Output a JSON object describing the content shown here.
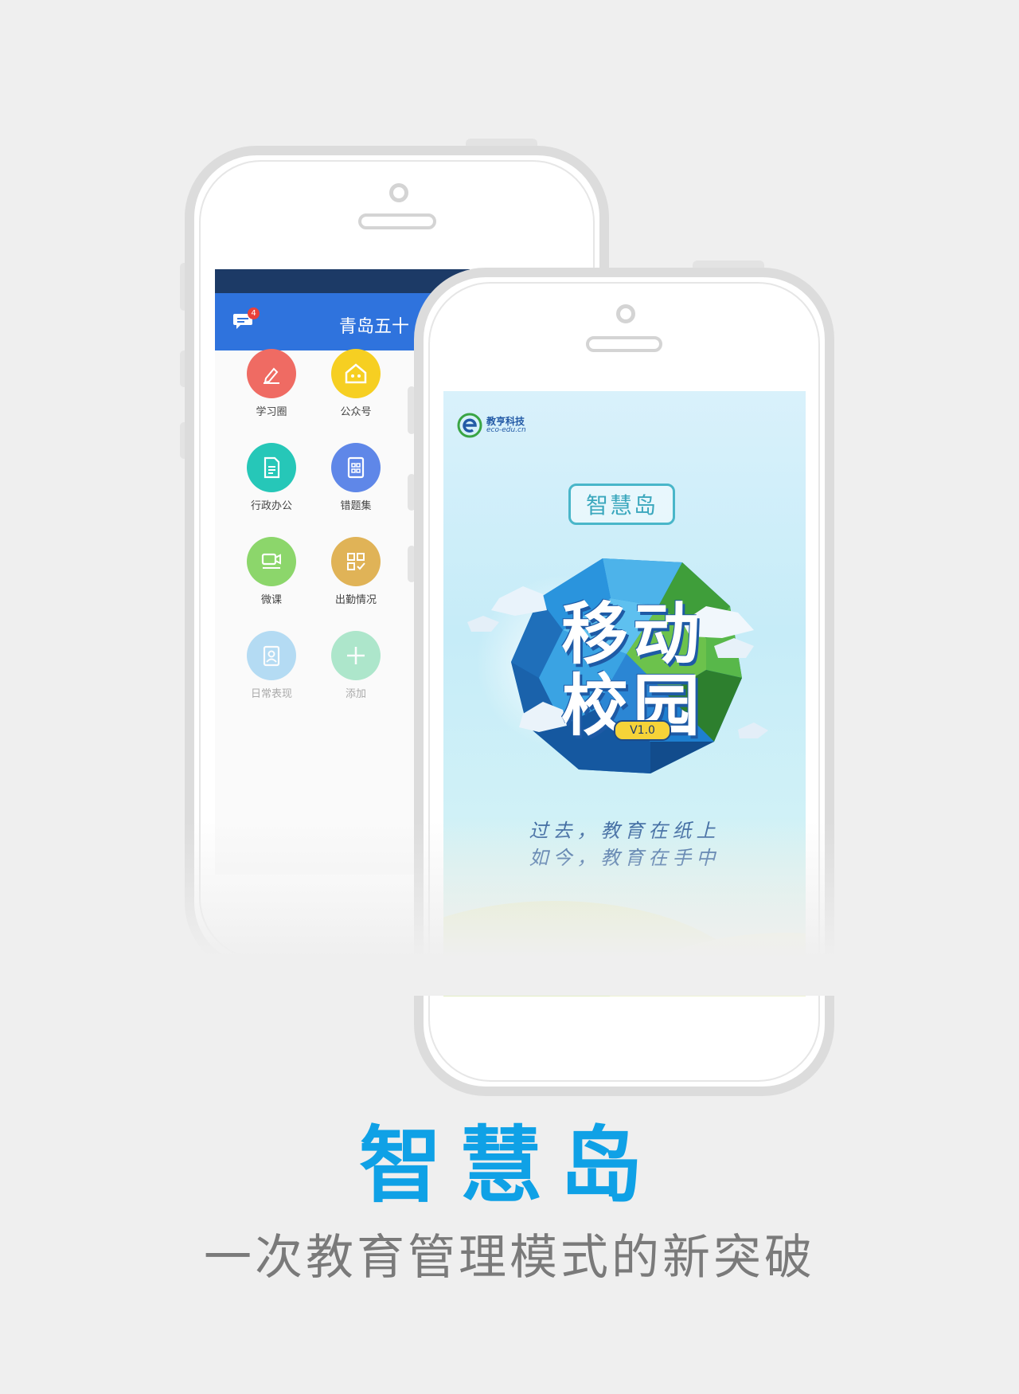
{
  "back_phone": {
    "header": {
      "title": "青岛五十",
      "unread_badge": "4"
    },
    "apps": [
      {
        "label": "学习圈",
        "icon": "pen-icon",
        "color": "#ef6b63"
      },
      {
        "label": "公众号",
        "icon": "house-icon",
        "color": "#f6cf22"
      },
      {
        "label": "行政办公",
        "icon": "document-icon",
        "color": "#26c7b8"
      },
      {
        "label": "错题集",
        "icon": "calculator-icon",
        "color": "#5f87e8"
      },
      {
        "label": "微课",
        "icon": "video-icon",
        "color": "#8cd66b"
      },
      {
        "label": "出勤情况",
        "icon": "attendance-icon",
        "color": "#e0b357"
      },
      {
        "label": "日常表现",
        "icon": "profile-card-icon",
        "color": "#7cc3ee"
      },
      {
        "label": "添加",
        "icon": "plus-icon",
        "color": "#6fd7a6"
      }
    ]
  },
  "front_phone": {
    "brand_name": "教亨科技",
    "brand_domain": "eco-edu.cn",
    "app_badge": "智慧岛",
    "splash_title_line1": "移动",
    "splash_title_line2": "校园",
    "version": "V1.0",
    "slogan_line1": "过去，教育在纸上",
    "slogan_line2": "如今，教育在手中"
  },
  "headline": "智慧岛",
  "subline": "一次教育管理模式的新突破",
  "colors": {
    "nav_bar": "#2f73dd",
    "status_bar": "#1c3a66",
    "headline": "#0fa1e6",
    "subline": "#7a7a7a",
    "background": "#efefef"
  }
}
